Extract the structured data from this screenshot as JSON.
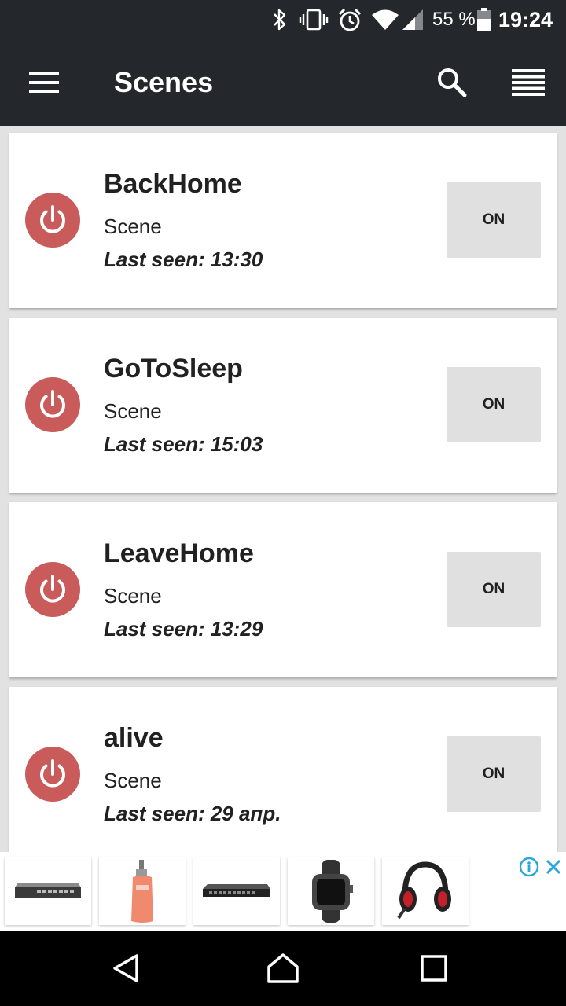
{
  "status_bar": {
    "battery_percent": "55 %",
    "time": "19:24",
    "icons": [
      "bluetooth-icon",
      "vibrate-icon",
      "alarm-icon",
      "wifi-icon",
      "signal-icon",
      "battery-icon"
    ]
  },
  "app_bar": {
    "title": "Scenes",
    "icons": [
      "menu-icon",
      "search-icon",
      "list-view-icon"
    ]
  },
  "scenes": [
    {
      "name": "BackHome",
      "type": "Scene",
      "last_seen": "Last seen: 13:30",
      "button": "ON"
    },
    {
      "name": "GoToSleep",
      "type": "Scene",
      "last_seen": "Last seen: 15:03",
      "button": "ON"
    },
    {
      "name": "LeaveHome",
      "type": "Scene",
      "last_seen": "Last seen: 13:29",
      "button": "ON"
    },
    {
      "name": "alive",
      "type": "Scene",
      "last_seen": "Last seen: 29 апр.",
      "button": "ON"
    }
  ],
  "colors": {
    "app_bar": "#24282d",
    "power_icon": "#c95b5b",
    "on_button": "#e0e0e0",
    "background": "#e2e2e2"
  },
  "ad_banner": {
    "products": [
      "network-switch",
      "cosmetic-bottle",
      "network-switch-rack",
      "smartwatch",
      "gaming-headset"
    ],
    "icons": [
      "ad-info-icon",
      "ad-close-icon"
    ]
  },
  "nav_bar": {
    "icons": [
      "back-icon",
      "home-icon",
      "recents-icon"
    ]
  }
}
